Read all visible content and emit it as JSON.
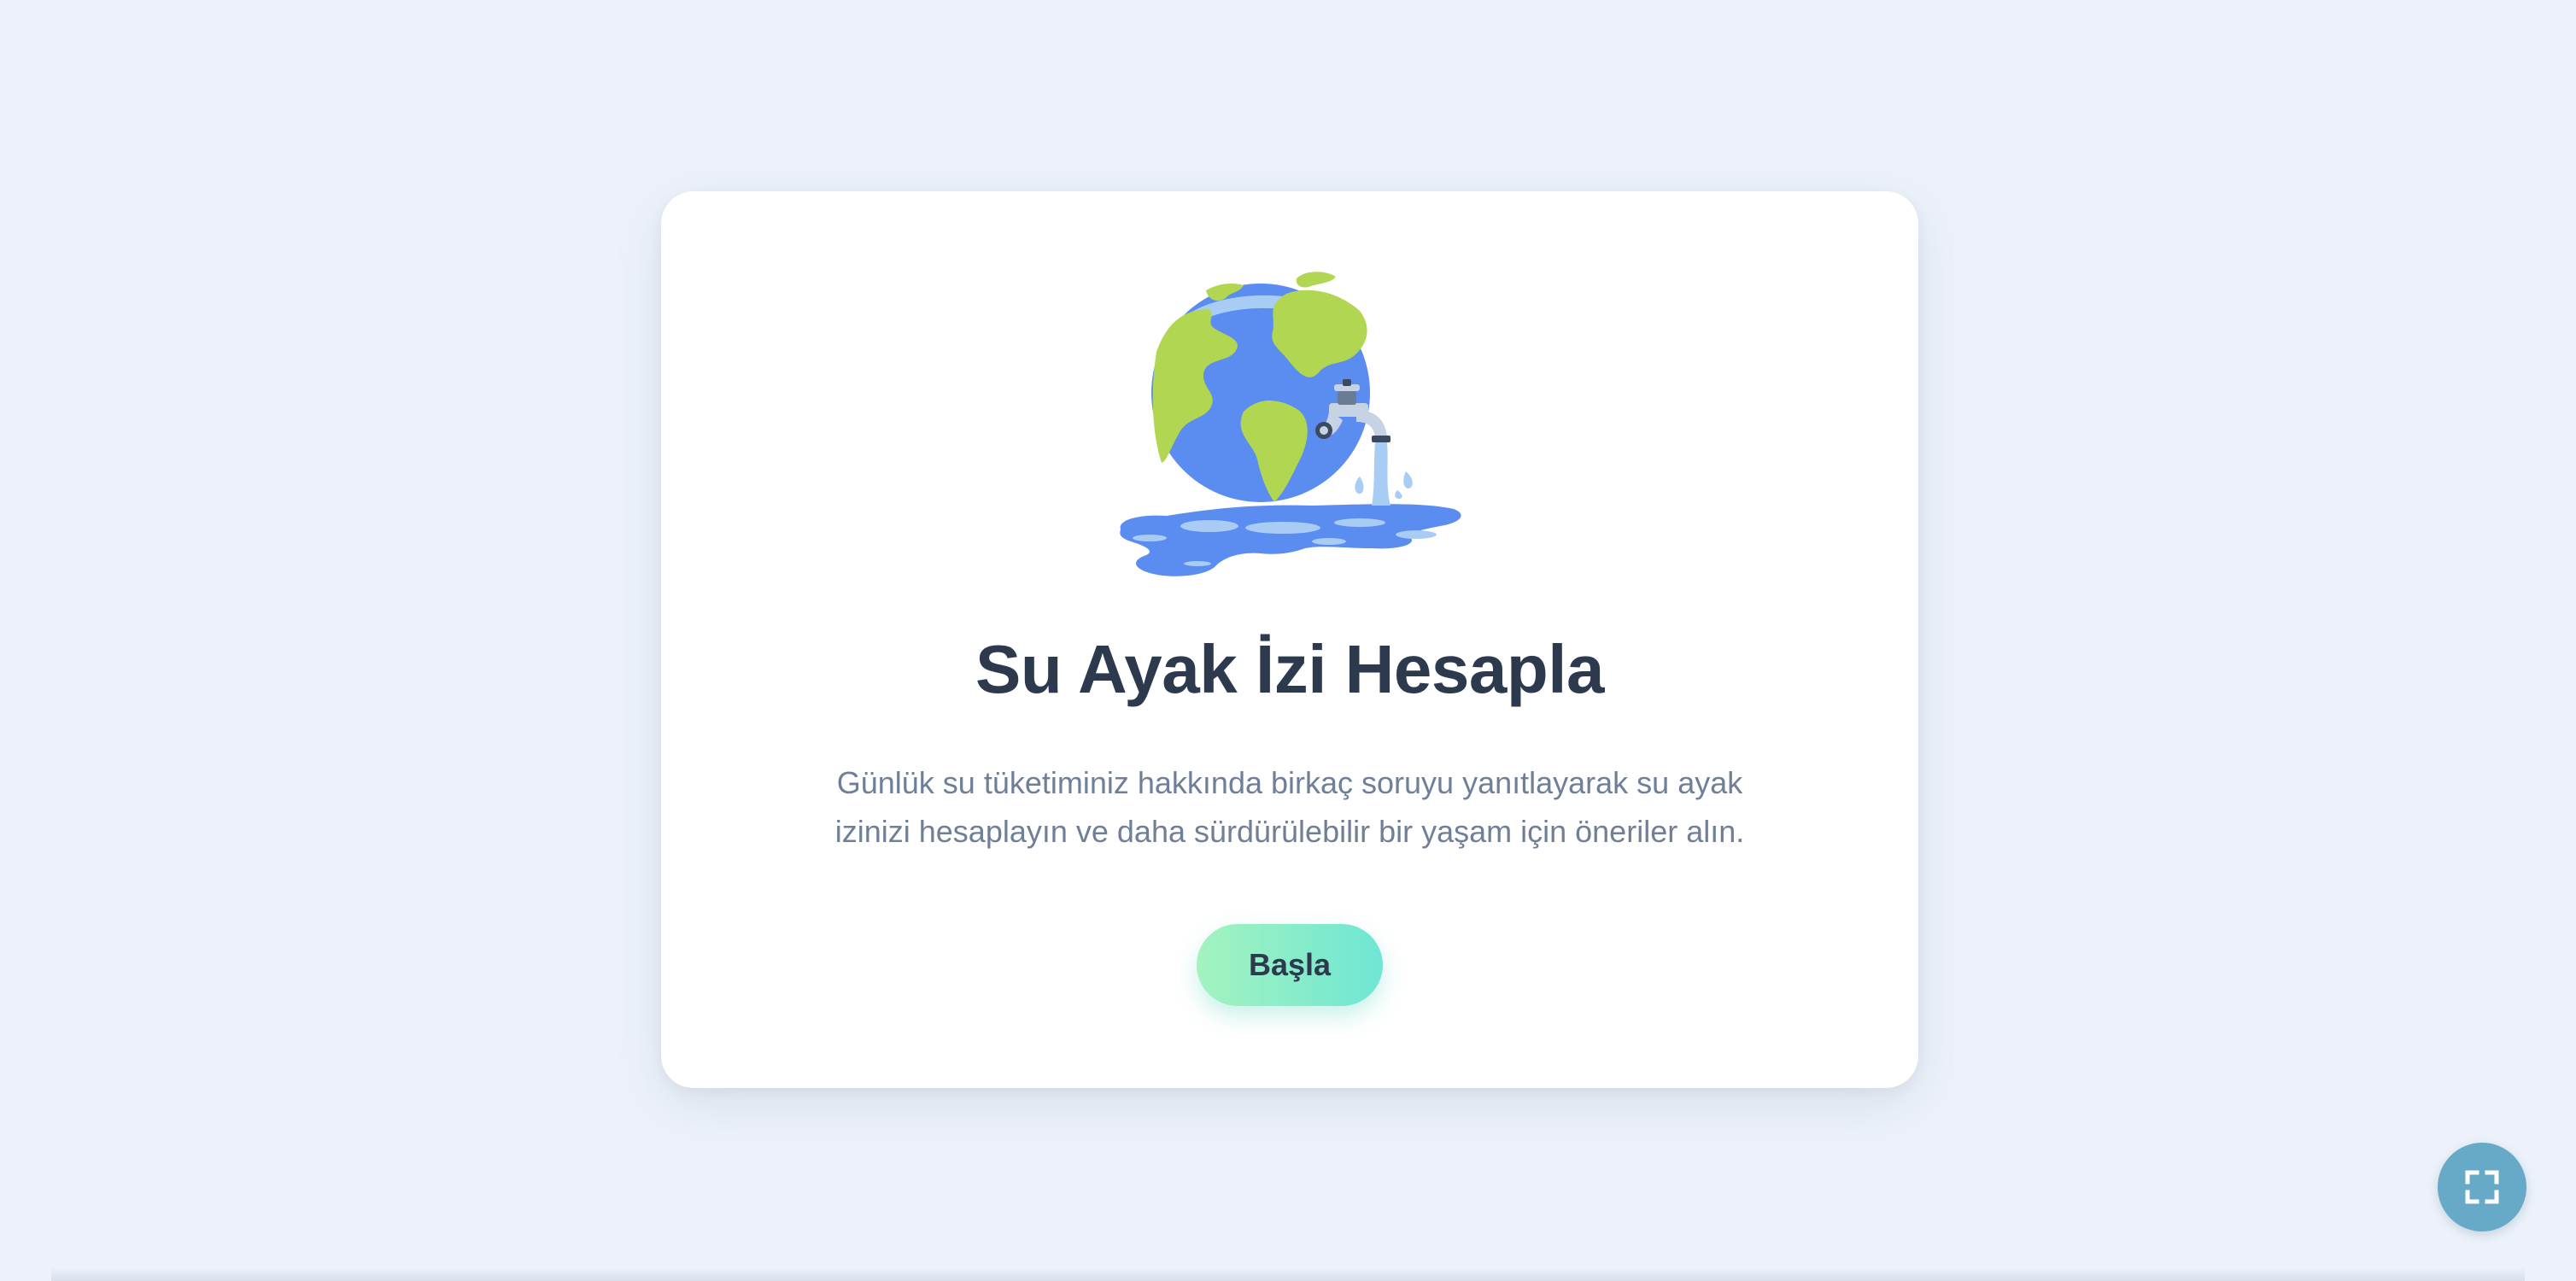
{
  "intro": {
    "illustration_icon": "earth-with-faucet-icon",
    "title": "Su Ayak İzi Hesapla",
    "description": "Günlük su tüketiminiz hakkında birkaç soruyu yanıtlayarak su ayak izinizi hesaplayın ve daha sürdürülebilir bir yaşam için öneriler alın.",
    "start_label": "Başla"
  },
  "controls": {
    "fullscreen_icon": "fullscreen-icon"
  },
  "colors": {
    "background": "#edf2fa",
    "card": "#ffffff",
    "title": "#2d3a4e",
    "description": "#6f7f97",
    "button_gradient_start": "#a3f3bf",
    "button_gradient_end": "#6fe6d4",
    "fullscreen_button": "#66aac7",
    "ocean": "#5b8cf0",
    "land": "#b1d652"
  }
}
